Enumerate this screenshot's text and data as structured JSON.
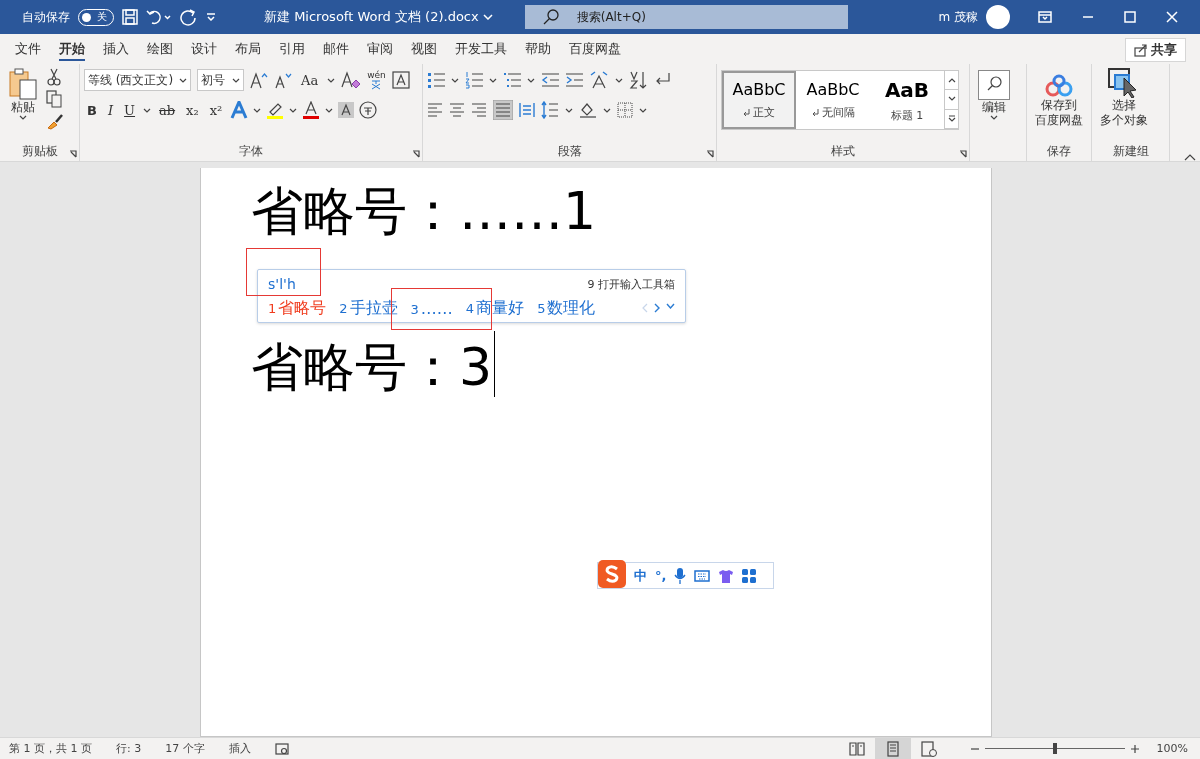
{
  "title_bar": {
    "autosave_label": "自动保存",
    "autosave_toggle": {
      "label": "关",
      "on": false
    },
    "doc_title": "新建 Microsoft Word 文档 (2).docx",
    "search_placeholder": "搜索(Alt+Q)",
    "user": "m 茂稼"
  },
  "menu_tabs": [
    {
      "label": "文件",
      "selected": false
    },
    {
      "label": "开始",
      "selected": true
    },
    {
      "label": "插入",
      "selected": false
    },
    {
      "label": "绘图",
      "selected": false
    },
    {
      "label": "设计",
      "selected": false
    },
    {
      "label": "布局",
      "selected": false
    },
    {
      "label": "引用",
      "selected": false
    },
    {
      "label": "邮件",
      "selected": false
    },
    {
      "label": "审阅",
      "selected": false
    },
    {
      "label": "视图",
      "selected": false
    },
    {
      "label": "开发工具",
      "selected": false
    },
    {
      "label": "帮助",
      "selected": false
    },
    {
      "label": "百度网盘",
      "selected": false
    }
  ],
  "share_button": "共享",
  "ribbon": {
    "clipboard": {
      "paste": "粘贴",
      "label": "剪贴板"
    },
    "font": {
      "font_name": "等线 (西文正文)",
      "font_size": "初号",
      "case_button": "Aa",
      "pinyin": "wén",
      "format_buttons": [
        "B",
        "I",
        "U",
        "ab",
        "x₂",
        "x²"
      ],
      "label": "字体"
    },
    "paragraph": {
      "label": "段落"
    },
    "styles": {
      "items": [
        {
          "preview": "AaBbC",
          "name": "正文",
          "selected": true,
          "kind": "normal"
        },
        {
          "preview": "AaBbC",
          "name": "无间隔",
          "selected": false,
          "kind": "normal"
        },
        {
          "preview": "AaB",
          "name": "标题 1",
          "selected": false,
          "kind": "heading"
        }
      ],
      "label": "样式"
    },
    "editing": {
      "button": "编辑"
    },
    "save": {
      "button_lines": [
        "保存到",
        "百度网盘"
      ],
      "label": "保存"
    },
    "new_group": {
      "button_lines": [
        "选择",
        "多个对象"
      ],
      "label": "新建组"
    }
  },
  "document": {
    "lines": [
      {
        "text": "省略号：……1",
        "cursor": false
      },
      {
        "text": "省略号：3",
        "cursor": true
      }
    ]
  },
  "ime_popup": {
    "input": "s'l'h",
    "toolbox": "9 打开输入工具箱",
    "candidates": [
      {
        "number": "1",
        "text": "省略号",
        "selected": true
      },
      {
        "number": "2",
        "text": "手拉壶",
        "selected": false
      },
      {
        "number": "3",
        "text": "……",
        "selected": false
      },
      {
        "number": "4",
        "text": "商量好",
        "selected": false
      },
      {
        "number": "5",
        "text": "数理化",
        "selected": false
      }
    ]
  },
  "ime_status": {
    "mode": "中",
    "punctuation": "°,"
  },
  "status_bar": {
    "items": [
      "第 1 页，共 1 页",
      "行: 3",
      "17 个字",
      "插入"
    ],
    "views": [
      {
        "kind": "read",
        "selected": false
      },
      {
        "kind": "print",
        "selected": true
      },
      {
        "kind": "web",
        "selected": false
      }
    ],
    "zoom": {
      "level": 0.5,
      "reading": "100%"
    }
  }
}
